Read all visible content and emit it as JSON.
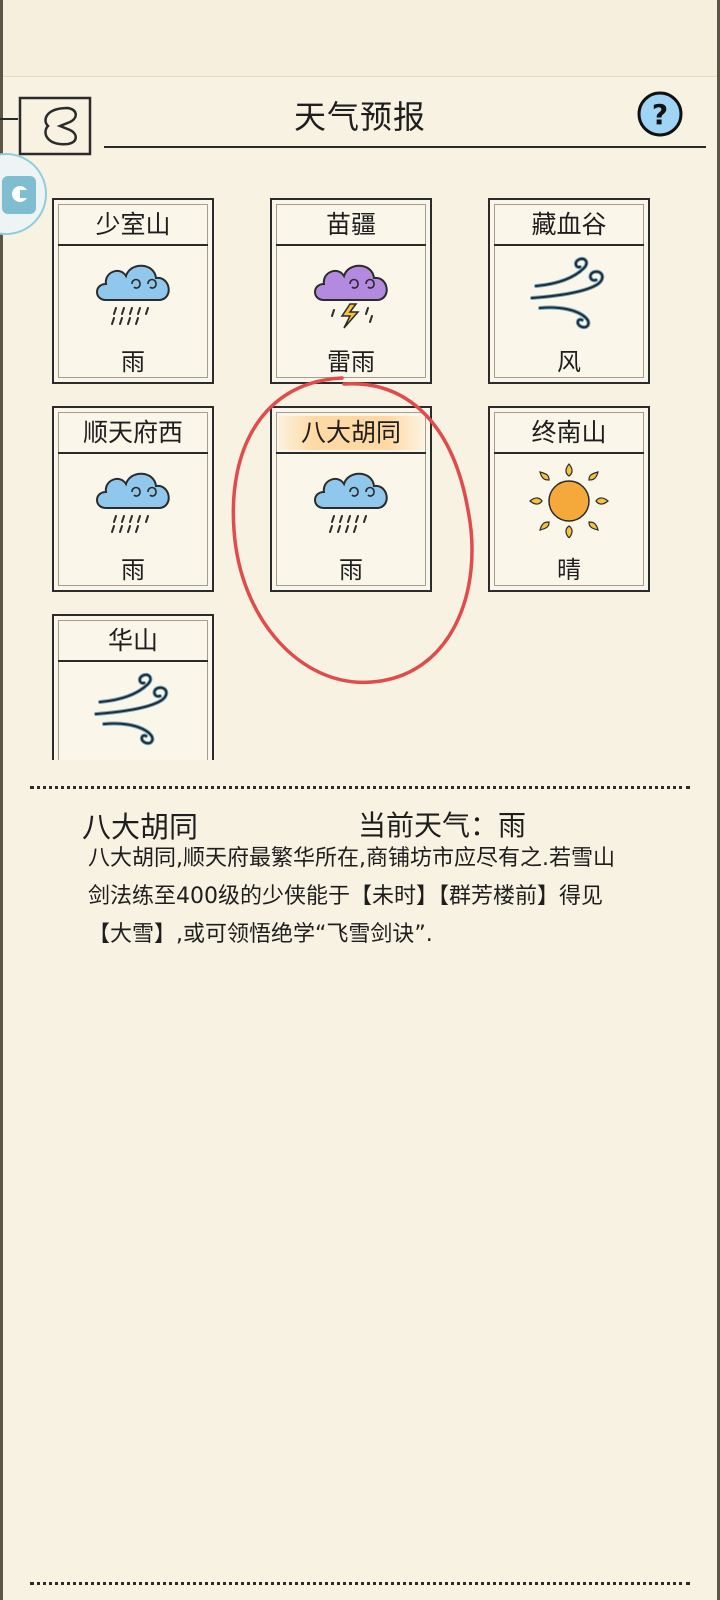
{
  "header": {
    "title": "天气预报",
    "help_label": "?"
  },
  "cards": [
    {
      "name": "少室山",
      "weather": "雨",
      "icon": "rain-cloud-icon"
    },
    {
      "name": "苗疆",
      "weather": "雷雨",
      "icon": "thunderstorm-icon"
    },
    {
      "name": "藏血谷",
      "weather": "风",
      "icon": "wind-icon"
    },
    {
      "name": "顺天府西",
      "weather": "雨",
      "icon": "rain-cloud-icon"
    },
    {
      "name": "八大胡同",
      "weather": "雨",
      "icon": "rain-cloud-icon"
    },
    {
      "name": "终南山",
      "weather": "晴",
      "icon": "sun-icon"
    },
    {
      "name": "华山",
      "weather": "",
      "icon": "wind-icon"
    }
  ],
  "selected": {
    "location": "八大胡同",
    "current_weather": "当前天气：雨",
    "description": "八大胡同,顺天府最繁华所在,商铺坊市应尽有之.若雪山剑法练至400级的少侠能于【未时】【群芳楼前】得见【大雪】,或可领悟绝学“飞雪剑诀”."
  },
  "colors": {
    "background": "#f8f2e2",
    "highlight": "#ffd9a3",
    "annotation": "#e04b4b",
    "rain_cloud": "#8fc8ec",
    "thunder_cloud": "#b48ae0",
    "sun": "#f6a93b"
  }
}
